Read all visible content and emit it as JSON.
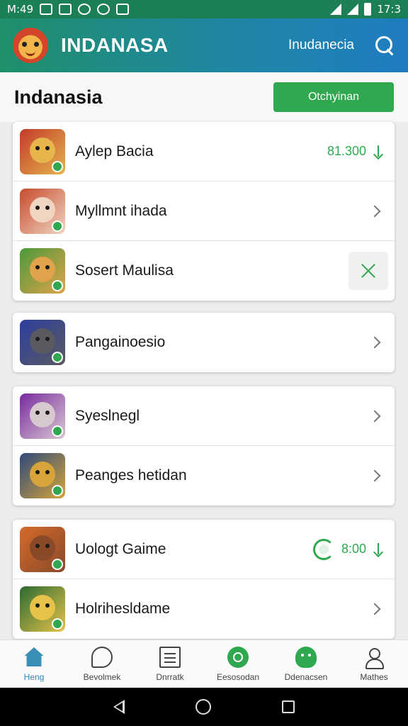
{
  "status_bar": {
    "time_left": "M:49",
    "time_right": "17:3"
  },
  "app_bar": {
    "title": "INDANASA",
    "subtitle": "Inudanecia"
  },
  "page": {
    "title": "Indanasia",
    "action_label": "Otchyinan"
  },
  "cards": [
    {
      "rows": [
        {
          "label": "Aylep Bacia",
          "right_text": "81.300",
          "right_icon": "download-arrow-icon",
          "colors": [
            "#c23a2a",
            "#e6b54c"
          ]
        },
        {
          "label": "Myllmnt ihada",
          "right_icon": "chevron-right-icon",
          "colors": [
            "#c84a2c",
            "#f0d6c2"
          ]
        },
        {
          "label": "Sosert Maulisa",
          "right_icon": "close-icon",
          "colors": [
            "#4a9a3a",
            "#e0a24a"
          ]
        }
      ]
    },
    {
      "rows": [
        {
          "label": "Pangainoesio",
          "right_icon": "chevron-right-icon",
          "colors": [
            "#2c3ea0",
            "#5a5a60"
          ]
        }
      ]
    },
    {
      "rows": [
        {
          "label": "Syeslnegl",
          "right_icon": "chevron-right-icon",
          "colors": [
            "#7a2aa0",
            "#d8c8d0"
          ]
        },
        {
          "label": "Peanges hetidan",
          "right_icon": "chevron-right-icon",
          "colors": [
            "#2e4a7a",
            "#d6a43a"
          ]
        }
      ]
    },
    {
      "rows": [
        {
          "label": "Uologt Gaime",
          "right_text": "8:00",
          "right_icon": "sync-ring-icon",
          "colors": [
            "#d46a2a",
            "#8a4a2a"
          ]
        },
        {
          "label": "Holrihesldame",
          "right_icon": "chevron-right-icon",
          "colors": [
            "#2a6a30",
            "#e6c24a"
          ]
        }
      ]
    }
  ],
  "bottom_nav": [
    {
      "label": "Heng",
      "icon": "home-icon",
      "active": true
    },
    {
      "label": "Bevolmek",
      "icon": "chat-bubble-icon",
      "active": false
    },
    {
      "label": "Dnrratk",
      "icon": "document-icon",
      "active": false
    },
    {
      "label": "Eesosodan",
      "icon": "circle-badge-icon",
      "active": false
    },
    {
      "label": "Ddenacsen",
      "icon": "smile-badge-icon",
      "active": false
    },
    {
      "label": "Mathes",
      "icon": "user-icon",
      "active": false
    }
  ],
  "colors": {
    "accent": "#2fa84f",
    "app_bar_start": "#1f8f6a",
    "app_bar_end": "#1f7cc0"
  }
}
